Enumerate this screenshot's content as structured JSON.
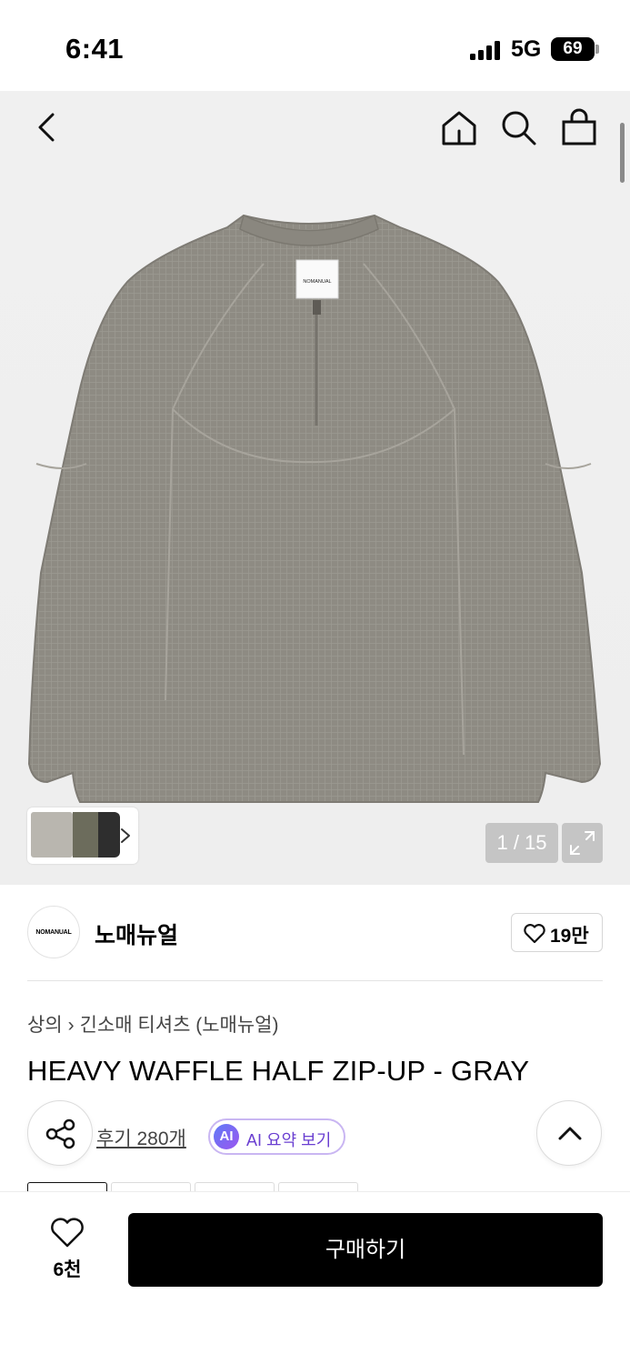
{
  "status_bar": {
    "time": "6:41",
    "network": "5G",
    "battery": "69"
  },
  "nav": {
    "back_icon": "chevron-left-icon",
    "home_icon": "home-icon",
    "search_icon": "search-icon",
    "bag_icon": "shopping-bag-icon"
  },
  "gallery": {
    "image_label": "NOMANUAL",
    "thumbnail_colors": [
      "#b9b6af",
      "#6c6c5c",
      "#2e2e2e"
    ],
    "page_counter": "1 / 15",
    "expand_icon": "expand-icon"
  },
  "brand": {
    "logo_text": "NOMANUAL",
    "name": "노매뉴얼",
    "like_count": "19만"
  },
  "product": {
    "breadcrumb": [
      "상의",
      "긴소매 티셔츠 (노매뉴얼)"
    ],
    "title": "HEAVY WAFFLE HALF ZIP-UP - GRAY"
  },
  "actions": {
    "share_icon": "share-icon",
    "review_link": "후기 280개",
    "ai_badge": "AI",
    "ai_summary": "AI 요약 보기",
    "scroll_top_icon": "chevron-up-icon"
  },
  "bottom_bar": {
    "wish_count": "6천",
    "buy_label": "구매하기"
  },
  "colors": {
    "ai_accent": "#6a3fd1",
    "garment": "#8d8a82",
    "buy_button": "#000000"
  }
}
